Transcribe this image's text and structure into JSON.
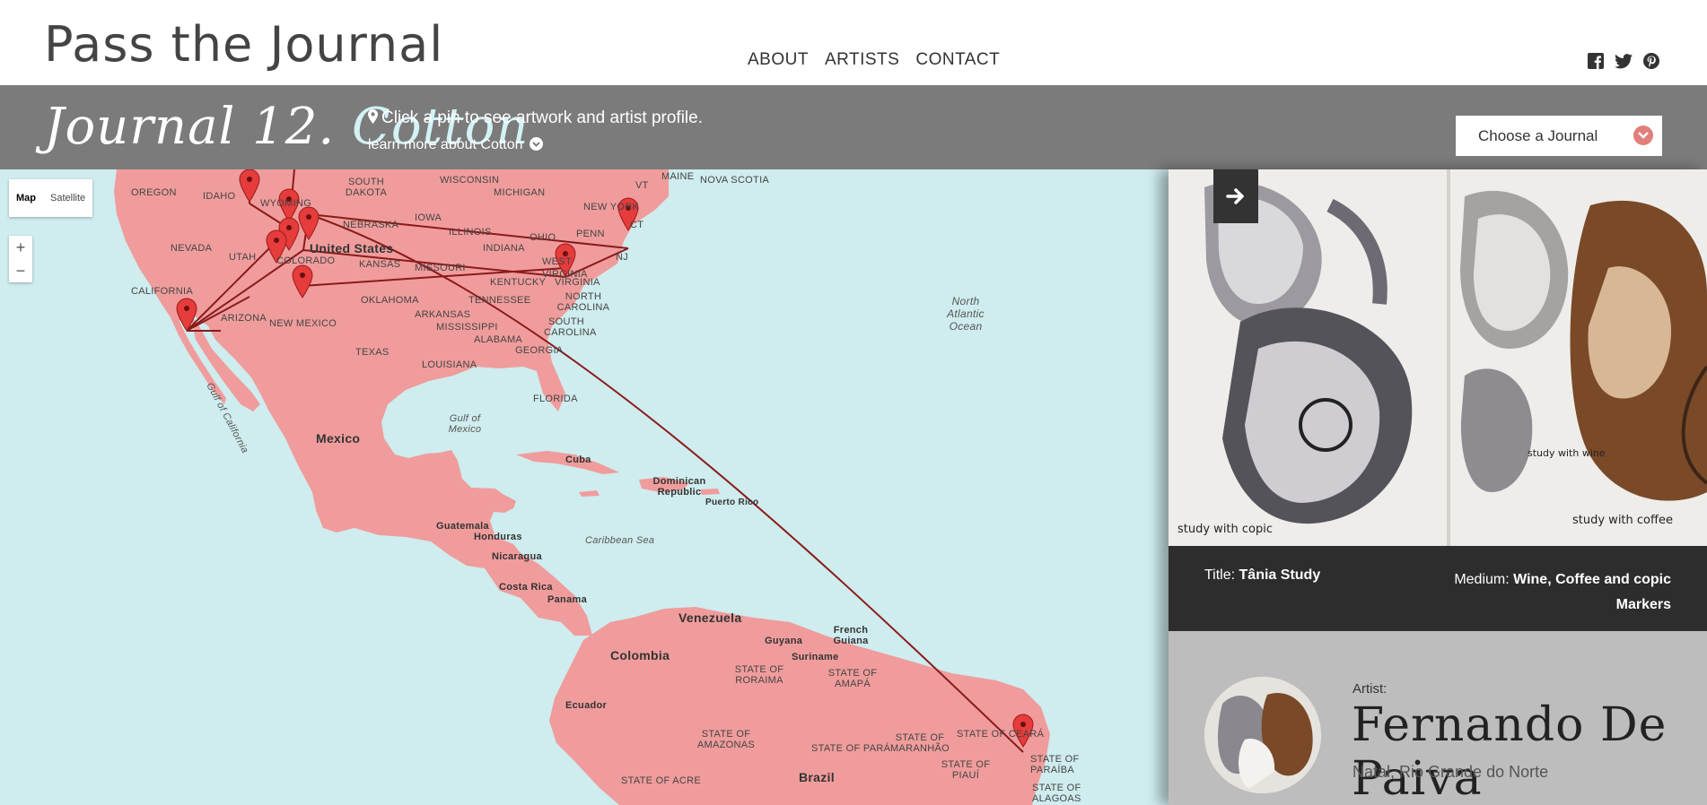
{
  "header": {
    "site_title": "Pass the Journal",
    "nav": [
      "ABOUT",
      "ARTISTS",
      "CONTACT"
    ],
    "social_icons": [
      "facebook-icon",
      "twitter-icon",
      "pinterest-icon"
    ]
  },
  "journal_bar": {
    "journal_number": "Journal 12.",
    "journal_name": "Cotton",
    "hint": "Click a pin to see artwork and artist profile.",
    "learn_more": "learn more about Cotton",
    "chooser_label": "Choose a Journal"
  },
  "map": {
    "type_buttons": [
      "Map",
      "Satellite"
    ],
    "zoom_in": "+",
    "zoom_out": "−",
    "land_color": "#f09c9c",
    "water_color": "#cfecee",
    "route_color": "#8a1a1a",
    "labels": {
      "oregon": "OREGON",
      "idaho": "IDAHO",
      "wyoming": "WYOMING",
      "south_dakota": "SOUTH DAKOTA",
      "wisconsin": "WISCONSIN",
      "michigan": "MICHIGAN",
      "maine": "MAINE",
      "nova_scotia": "NOVA SCOTIA",
      "vt": "VT",
      "new_york": "NEW YORK",
      "nebraska": "NEBRASKA",
      "iowa": "IOWA",
      "illinois": "ILLINOIS",
      "ohio": "OHIO",
      "penn": "PENN",
      "ct": "CT",
      "nevada": "NEVADA",
      "utah": "UTAH",
      "united_states": "United States",
      "indiana": "INDIANA",
      "nj": "NJ",
      "kansas": "KANSAS",
      "missouri": "MISSOURI",
      "west_virginia": "WEST VIRGINIA",
      "virginia": "VIRGINIA",
      "california": "CALIFORNIA",
      "kentucky": "KENTUCKY",
      "colorado": "COLORADO",
      "oklahoma": "OKLAHOMA",
      "tennessee": "TENNESSEE",
      "north_carolina": "NORTH CAROLINA",
      "arizona": "ARIZONA",
      "new_mexico": "NEW MEXICO",
      "arkansas": "ARKANSAS",
      "mississippi": "MISSISSIPPI",
      "south_carolina": "SOUTH CAROLINA",
      "alabama": "ALABAMA",
      "georgia": "GEORGIA",
      "texas": "TEXAS",
      "louisiana": "LOUISIANA",
      "florida": "FLORIDA",
      "north_atlantic": "North Atlantic Ocean",
      "gulf_of_california": "Gulf of California",
      "mexico": "Mexico",
      "gulf_of_mexico": "Gulf of Mexico",
      "cuba": "Cuba",
      "dominican_republic": "Dominican Republic",
      "puerto_rico": "Puerto Rico",
      "guatemala": "Guatemala",
      "honduras": "Honduras",
      "caribbean_sea": "Caribbean Sea",
      "nicaragua": "Nicaragua",
      "costa_rica": "Costa Rica",
      "panama": "Panama",
      "venezuela": "Venezuela",
      "french_guiana": "French Guiana",
      "guyana": "Guyana",
      "suriname": "Suriname",
      "colombia": "Colombia",
      "state_of_roraima": "STATE OF RORAIMA",
      "state_of_amapa": "STATE OF AMAPÁ",
      "ecuador": "Ecuador",
      "state_of_amazonas": "STATE OF AMAZONAS",
      "state_of_para": "STATE OF PARÁ",
      "state_of_maranhao": "STATE OF MARANHÃO",
      "state_of_ceara": "STATE OF CEARÁ",
      "state_of_paraiba": "STATE OF PARAÍBA",
      "state_of_piaui": "STATE OF PIAUÍ",
      "state_of_acre": "STATE OF ACRE",
      "brazil": "Brazil",
      "state_of_alagoas": "STATE OF ALAGOAS"
    }
  },
  "artwork": {
    "title_label": "Title:",
    "title_value": "Tânia Study",
    "medium_label": "Medium:",
    "medium_value": "Wine, Coffee and copic Markers",
    "caption_left": "study with copic",
    "caption_right": "study with coffee",
    "caption_middle": "study with wine"
  },
  "artist": {
    "label": "Artist:",
    "name": "Fernando De Paiva",
    "location": "Natal, Rio Grande do Norte"
  }
}
